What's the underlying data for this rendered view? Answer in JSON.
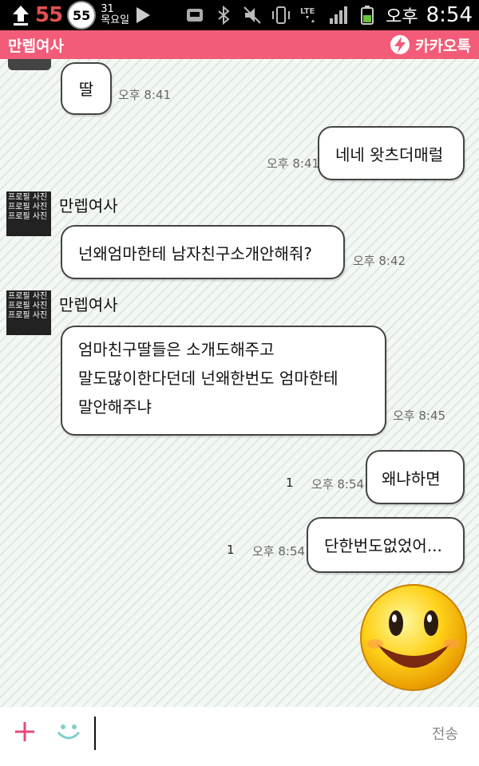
{
  "status_bar": {
    "battery_percent": "55",
    "badge": "55",
    "date_day": "31",
    "date_weekday": "목요일",
    "time_ampm": "오후",
    "time": "8:54",
    "icons": [
      "upload-icon",
      "notification-badge-icon",
      "play-icon",
      "sd-card-icon",
      "bluetooth-icon",
      "vibrate-icon",
      "rotation-icon",
      "lte-icon",
      "signal-icon",
      "battery-icon"
    ]
  },
  "header": {
    "title": "만렙여사",
    "brand": "카카오톡",
    "accent": "#f25c78"
  },
  "avatar_alt": "프로필 사진 프로필 사진 프로필 사진",
  "messages": [
    {
      "from": "other",
      "text": "딸",
      "time": "오후 8:41"
    },
    {
      "from": "me",
      "text": "네네 왓츠더매럴",
      "time": "오후 8:41"
    },
    {
      "from": "other",
      "sender": "만렙여사",
      "text": "넌왜엄마한테 남자친구소개안해줘?",
      "time": "오후 8:42"
    },
    {
      "from": "other",
      "sender": "만렙여사",
      "lines": [
        "엄마친구딸들은 소개도해주고",
        "말도많이한다던데 넌왜한번도 엄마한테",
        "말안해주냐"
      ],
      "time": "오후 8:45"
    },
    {
      "from": "me",
      "text": "왜냐하면",
      "time": "오후 8:54",
      "unread": "1"
    },
    {
      "from": "me",
      "text": "단한번도없었어...",
      "time": "오후 8:54",
      "unread": "1"
    },
    {
      "from": "me",
      "emoticon": "smiley-emoticon"
    }
  ],
  "input_bar": {
    "send_label": "전송",
    "plus_icon": "plus-icon",
    "emoticon_icon": "emoticon-icon"
  }
}
